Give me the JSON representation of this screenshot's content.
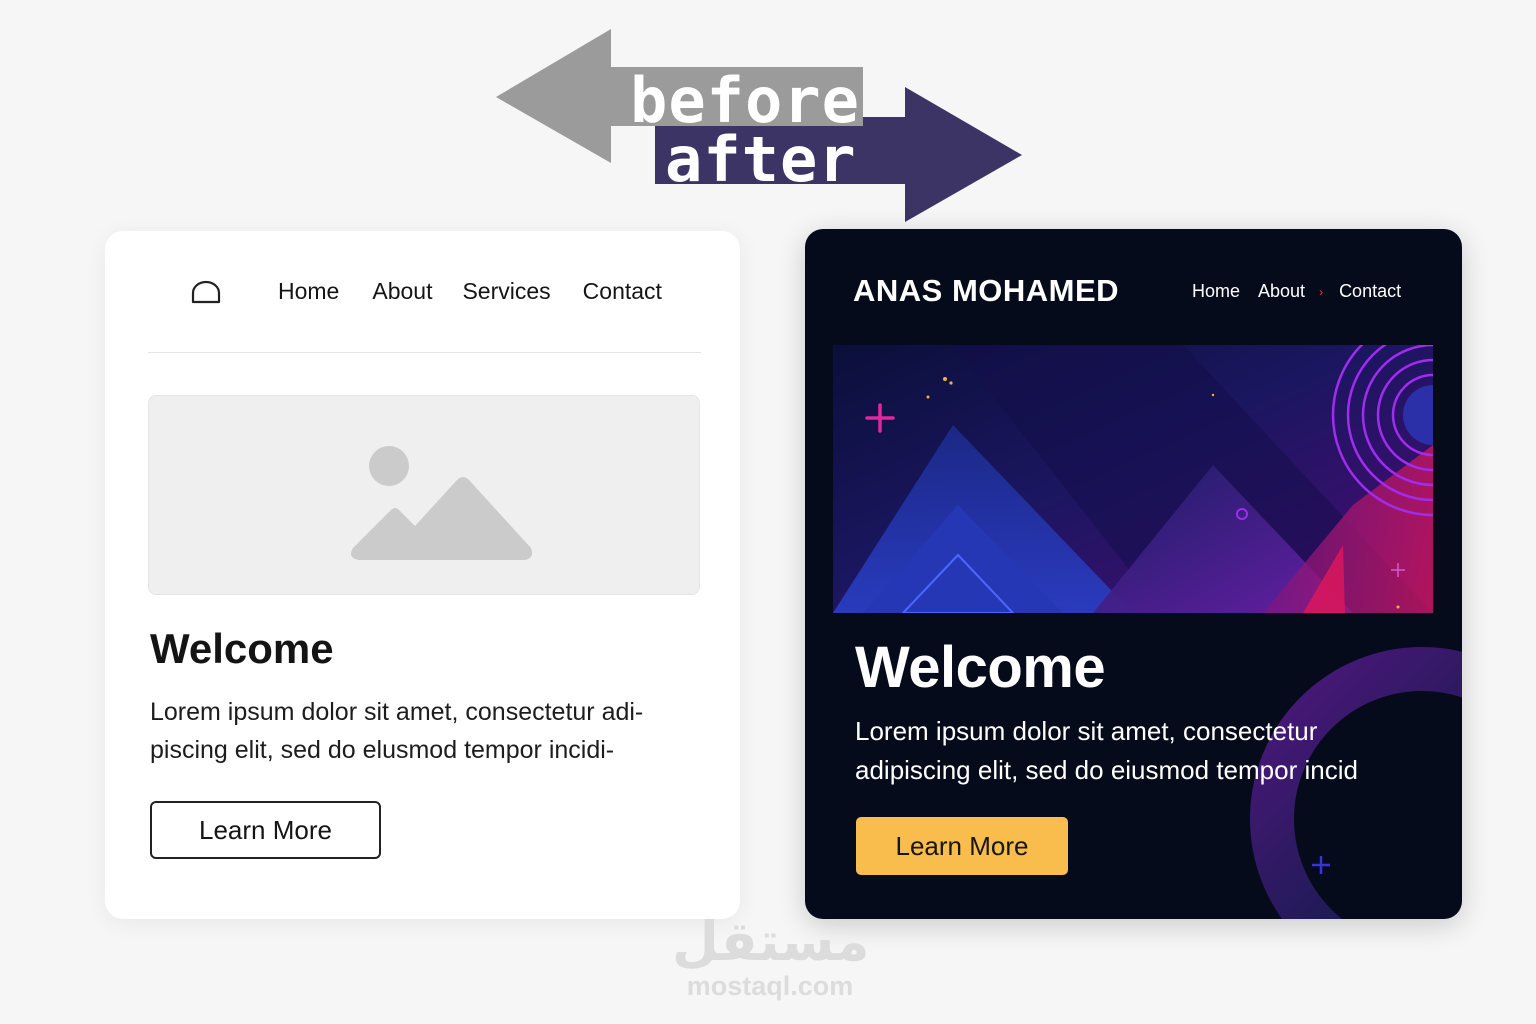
{
  "banner": {
    "before_label": "before",
    "after_label": "after",
    "colors": {
      "before": "#9b9b9b",
      "after": "#3d3466"
    }
  },
  "before": {
    "logo_icon": "dome-outline-icon",
    "nav": [
      "Home",
      "About",
      "Services",
      "Contact"
    ],
    "image_icon": "image-placeholder-icon",
    "title": "Welcome",
    "text": "Lorem ipsum dolor sit amet, consectetur adi-piscing elit, sed do elusmod tempor incidi-",
    "button": "Learn More"
  },
  "after": {
    "brand": "ANAS MOHAMED",
    "nav": [
      "Home",
      "About",
      "Contact"
    ],
    "nav_separator": "›",
    "title": "Welcome",
    "text": "Lorem ipsum dolor sit amet,  consectetur adipiscing elit, sed do eiusmod tempor incid",
    "button": "Learn More",
    "colors": {
      "background": "#060b1c",
      "button": "#f8bd4c",
      "accent": "#e0279e"
    }
  },
  "watermark": {
    "arabic": "مستقل",
    "latin": "mostaql.com"
  }
}
